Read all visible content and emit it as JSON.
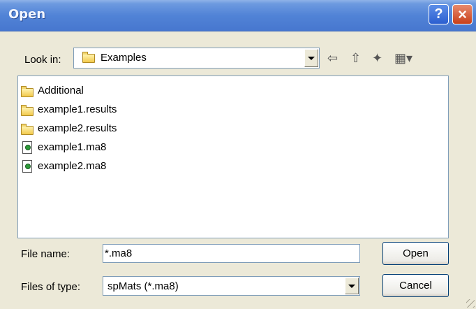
{
  "window": {
    "title": "Open",
    "help_glyph": "?",
    "close_glyph": "×"
  },
  "look_in": {
    "label": "Look in:",
    "value": "Examples"
  },
  "toolbar": {
    "back_glyph": "⇦",
    "up_glyph": "⇧",
    "new_folder_glyph": "✦",
    "views_glyph": "▦▾"
  },
  "files": [
    {
      "name": "Additional",
      "type": "folder"
    },
    {
      "name": "example1.results",
      "type": "folder"
    },
    {
      "name": "example2.results",
      "type": "folder"
    },
    {
      "name": "example1.ma8",
      "type": "file"
    },
    {
      "name": "example2.ma8",
      "type": "file"
    }
  ],
  "file_name": {
    "label": "File name:",
    "value": "*.ma8"
  },
  "file_type": {
    "label": "Files of type:",
    "value": "spMats (*.ma8)"
  },
  "buttons": {
    "open": "Open",
    "cancel": "Cancel"
  },
  "colors": {
    "title_bar": "#4777CF",
    "dialog_bg": "#ECE9D8",
    "border": "#7F9DB9"
  }
}
